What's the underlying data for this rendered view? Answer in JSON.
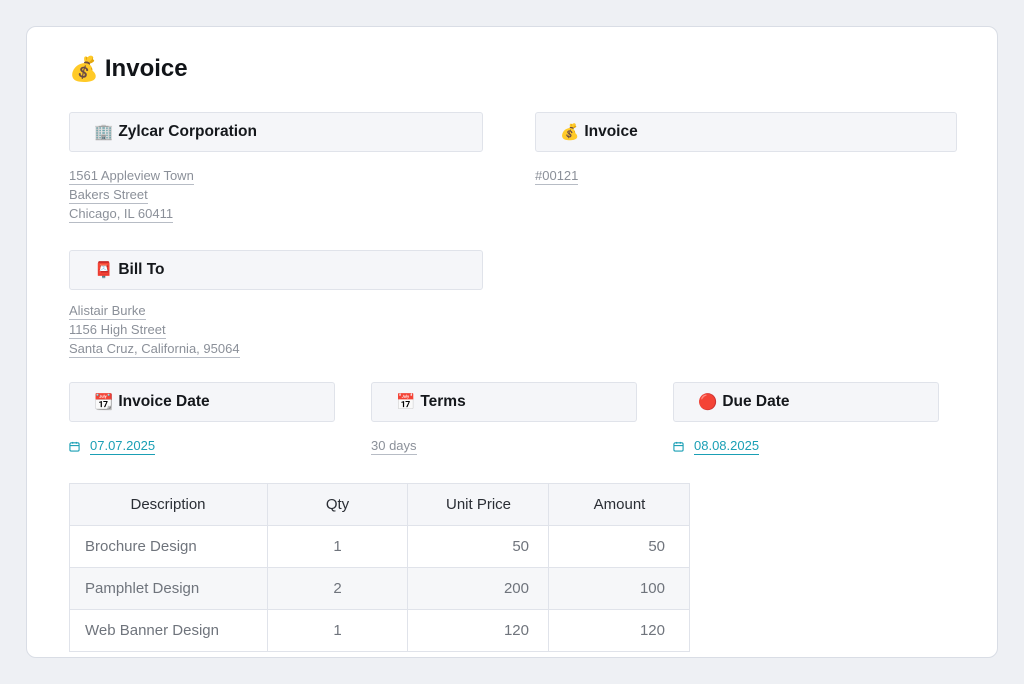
{
  "page": {
    "title": "Invoice",
    "title_icon": "💰"
  },
  "company": {
    "icon": "🏢",
    "label": "Zylcar Corporation",
    "address": [
      "1561 Appleview Town",
      "Bakers Street",
      "Chicago, IL 60411"
    ]
  },
  "invoice": {
    "icon": "💰",
    "label": "Invoice",
    "number": "#00121"
  },
  "bill_to": {
    "icon": "📮",
    "label": "Bill To",
    "address": [
      "Alistair Burke",
      "1156 High Street",
      "Santa Cruz, California, 95064"
    ]
  },
  "invoice_date": {
    "icon": "📆",
    "label": "Invoice Date",
    "value": "07.07.2025"
  },
  "terms": {
    "icon": "📅",
    "label": "Terms",
    "value": "30 days"
  },
  "due_date": {
    "icon": "🔴",
    "label": "Due Date",
    "value": "08.08.2025"
  },
  "table": {
    "headers": [
      "Description",
      "Qty",
      "Unit Price",
      "Amount"
    ],
    "rows": [
      [
        "Brochure Design",
        "1",
        "50",
        "50"
      ],
      [
        "Pamphlet Design",
        "2",
        "200",
        "100"
      ],
      [
        "Web Banner Design",
        "1",
        "120",
        "120"
      ]
    ]
  },
  "colors": {
    "accent": "#1a9fb5",
    "header_bg": "#f5f6f9",
    "muted_text": "#8b9099"
  }
}
